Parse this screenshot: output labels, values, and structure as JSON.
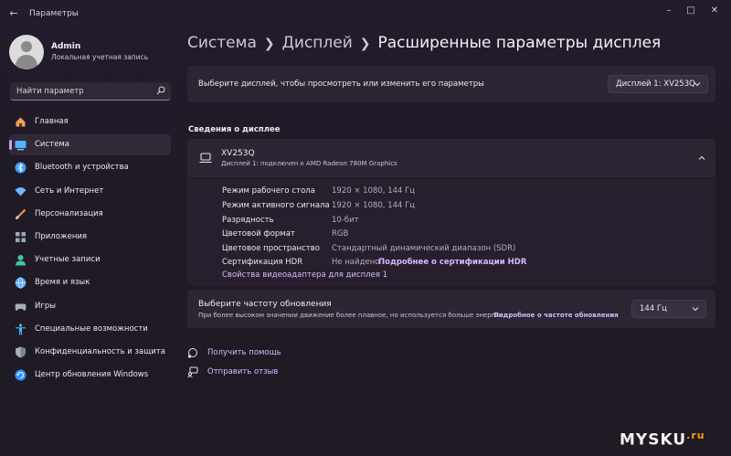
{
  "window": {
    "title": "Параметры"
  },
  "profile": {
    "name": "Admin",
    "account_type": "Локальная учетная запись"
  },
  "search": {
    "placeholder": "Найти параметр"
  },
  "nav": [
    {
      "id": "home",
      "label": "Главная",
      "icon": "home-icon",
      "color": "#f0a35a"
    },
    {
      "id": "system",
      "label": "Система",
      "icon": "monitor-icon",
      "color": "#4fb3ff",
      "active": true
    },
    {
      "id": "bluetooth",
      "label": "Bluetooth и устройства",
      "icon": "bluetooth-icon",
      "color": "#3da0ff"
    },
    {
      "id": "network",
      "label": "Сеть и Интернет",
      "icon": "wifi-icon",
      "color": "#6bb8ff"
    },
    {
      "id": "personalization",
      "label": "Персонализация",
      "icon": "brush-icon",
      "color": "#f08f45"
    },
    {
      "id": "apps",
      "label": "Приложения",
      "icon": "apps-icon",
      "color": "#9ca7b8"
    },
    {
      "id": "accounts",
      "label": "Учетные записи",
      "icon": "person-icon",
      "color": "#3fc7a5"
    },
    {
      "id": "time",
      "label": "Время и язык",
      "icon": "globe-clock-icon",
      "color": "#5aa9ff"
    },
    {
      "id": "gaming",
      "label": "Игры",
      "icon": "gamepad-icon",
      "color": "#a5aeb9"
    },
    {
      "id": "accessibility",
      "label": "Специальные возможности",
      "icon": "accessibility-icon",
      "color": "#4bb4ff"
    },
    {
      "id": "privacy",
      "label": "Конфиденциальность и защита",
      "icon": "shield-icon",
      "color": "#a8b0ba"
    },
    {
      "id": "update",
      "label": "Центр обновления Windows",
      "icon": "update-icon",
      "color": "#2f8fff"
    }
  ],
  "breadcrumb": {
    "level1": "Система",
    "level2": "Дисплей",
    "current": "Расширенные параметры дисплея"
  },
  "display_select": {
    "label": "Выберите дисплей, чтобы просмотреть или изменить его параметры",
    "value": "Дисплей 1: XV253Q"
  },
  "section_title": "Сведения о дисплее",
  "monitor": {
    "name": "XV253Q",
    "description": "Дисплей 1: подключен к AMD Radeon 780M Graphics",
    "details": [
      {
        "key": "Режим рабочего стола",
        "value": "1920 × 1080, 144 Гц"
      },
      {
        "key": "Режим активного сигнала",
        "value": "1920 × 1080, 144 Гц"
      },
      {
        "key": "Разрядность",
        "value": "10-бит"
      },
      {
        "key": "Цветовой формат",
        "value": "RGB"
      },
      {
        "key": "Цветовое пространство",
        "value": "Стандартный динамический диапазон (SDR)"
      },
      {
        "key": "Сертификация HDR",
        "value": "Не найдено",
        "link": "Подробнее о сертификации HDR"
      }
    ],
    "adapter_link": "Свойства видеоадаптера для дисплея 1"
  },
  "refresh": {
    "title": "Выберите частоту обновления",
    "description": "При более высоком значении движение более плавное, но используется больше энергии",
    "link": "Подробное о частоте обновления",
    "value": "144 Гц"
  },
  "help": {
    "get_help": "Получить помощь",
    "feedback": "Отправить отзыв"
  },
  "watermark": {
    "main": "MYSKU",
    "suffix": ".ru"
  },
  "colors": {
    "accent": "#d9b8ff",
    "indicator": "#c49ef0",
    "background": "#221b27",
    "card": "#2c2533"
  }
}
